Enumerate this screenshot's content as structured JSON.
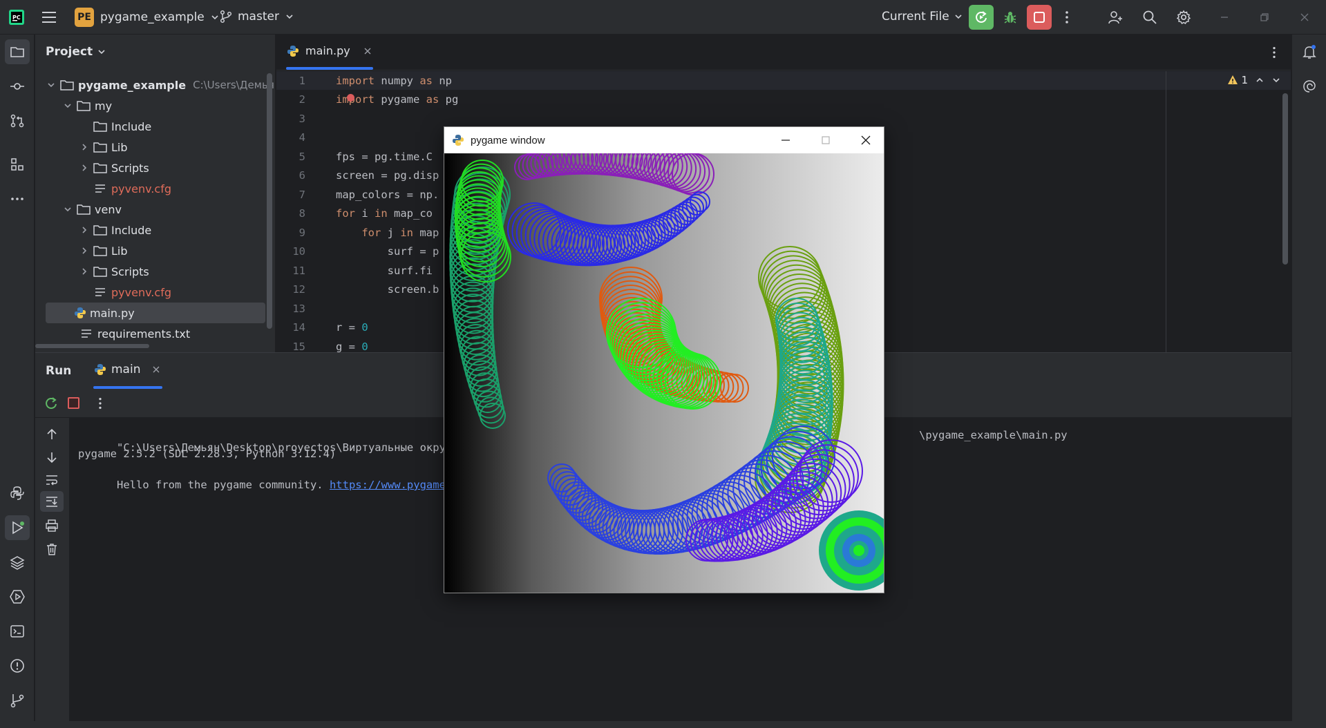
{
  "titlebar": {
    "project_badge": "PE",
    "project_name": "pygame_example",
    "branch": "master",
    "run_config": "Current File"
  },
  "project_panel": {
    "title": "Project",
    "root": {
      "name": "pygame_example",
      "path": "C:\\Users\\Демьян"
    },
    "items": [
      {
        "label": "my"
      },
      {
        "label": "Include"
      },
      {
        "label": "Lib"
      },
      {
        "label": "Scripts"
      },
      {
        "label": "pyvenv.cfg"
      },
      {
        "label": "venv"
      },
      {
        "label": "Include"
      },
      {
        "label": "Lib"
      },
      {
        "label": "Scripts"
      },
      {
        "label": "pyvenv.cfg"
      },
      {
        "label": "main.py"
      },
      {
        "label": "requirements.txt"
      }
    ]
  },
  "editor": {
    "tab_label": "main.py",
    "inspection_count": "1",
    "lines": [
      {
        "n": "1",
        "parts": [
          [
            "kw",
            "import"
          ],
          [
            "t",
            " numpy "
          ],
          [
            "kw",
            "as"
          ],
          [
            "t",
            " np"
          ]
        ]
      },
      {
        "n": "2",
        "parts": [
          [
            "kw",
            "import"
          ],
          [
            "t",
            " pygame "
          ],
          [
            "kw",
            "as"
          ],
          [
            "t",
            " pg"
          ]
        ]
      },
      {
        "n": "3",
        "parts": []
      },
      {
        "n": "4",
        "parts": []
      },
      {
        "n": "5",
        "parts": [
          [
            "t",
            "fps = pg.time.C"
          ]
        ]
      },
      {
        "n": "6",
        "parts": [
          [
            "t",
            "screen = pg.disp"
          ]
        ]
      },
      {
        "n": "7",
        "parts": [
          [
            "t",
            "map_colors = np."
          ]
        ]
      },
      {
        "n": "8",
        "parts": [
          [
            "kw",
            "for"
          ],
          [
            "t",
            " i "
          ],
          [
            "kw",
            "in"
          ],
          [
            "t",
            " map_co"
          ]
        ]
      },
      {
        "n": "9",
        "parts": [
          [
            "t",
            "    "
          ],
          [
            "kw",
            "for"
          ],
          [
            "t",
            " j "
          ],
          [
            "kw",
            "in"
          ],
          [
            "t",
            " map"
          ]
        ]
      },
      {
        "n": "10",
        "parts": [
          [
            "t",
            "        surf = p"
          ]
        ]
      },
      {
        "n": "11",
        "parts": [
          [
            "t",
            "        surf.fi"
          ]
        ]
      },
      {
        "n": "12",
        "parts": [
          [
            "t",
            "        screen.b"
          ]
        ]
      },
      {
        "n": "13",
        "parts": []
      },
      {
        "n": "14",
        "parts": [
          [
            "t",
            "r = "
          ],
          [
            "num",
            "0"
          ]
        ]
      },
      {
        "n": "15",
        "parts": [
          [
            "t",
            "g = "
          ],
          [
            "num",
            "0"
          ]
        ]
      }
    ]
  },
  "run_panel": {
    "title": "Run",
    "tab_label": "main",
    "output": {
      "line1": "\"C:\\Users\\Демьян\\Desktop\\proyectos\\Виртуальные окруже",
      "line1_tail": "\\pygame_example\\main.py",
      "line2": "pygame 2.5.2 (SDL 2.28.3, Python 3.12.4)",
      "line3_text": "Hello from the pygame community. ",
      "line3_link": "https://www.pygame.o"
    }
  },
  "pygame_window": {
    "title": "pygame window"
  },
  "colors": {
    "accent_run": "#5fb865",
    "accent_stop": "#db5c5c",
    "keyword": "#cf8e6d",
    "number": "#2aacb8",
    "cfg_file": "#e06c5a",
    "link": "#548af7"
  }
}
